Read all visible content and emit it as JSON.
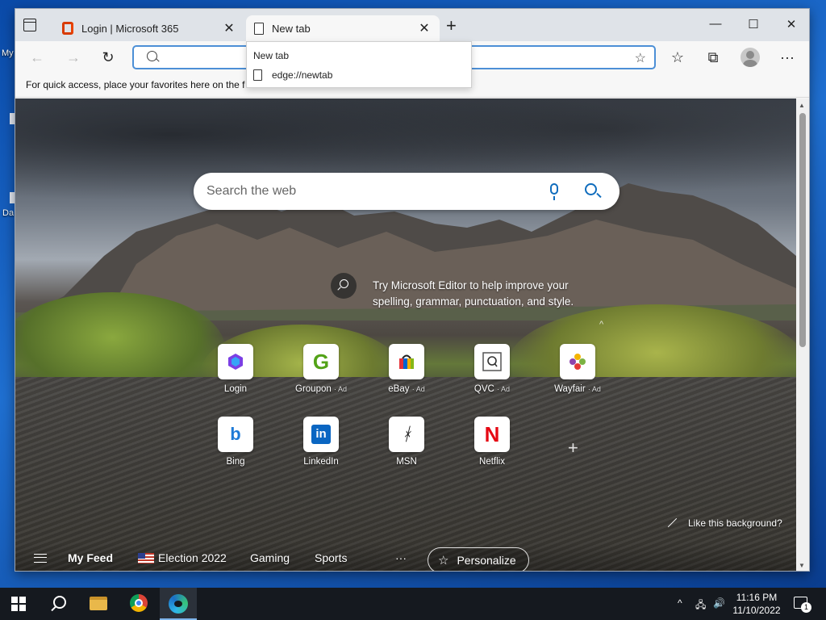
{
  "desktop": {
    "labels": [
      "My",
      "Da"
    ]
  },
  "browser": {
    "tabs": [
      {
        "title": "Login | Microsoft 365",
        "favicon": "office-icon",
        "active": false
      },
      {
        "title": "New tab",
        "favicon": "page-icon",
        "active": true
      }
    ],
    "new_tab_symbol": "+",
    "close_symbol": "✕",
    "window_controls": {
      "minimize": "—",
      "maximize": "☐",
      "close": "✕"
    },
    "nav": {
      "back": "←",
      "forward": "→",
      "refresh": "↻"
    },
    "address": {
      "value": "",
      "placeholder": ""
    },
    "toolbar_icons": {
      "favorites": "☆",
      "collections": "⧉",
      "menu": "···"
    },
    "favorites_bar_text": "For quick access, place your favorites here on the f",
    "dropdown": {
      "title": "New tab",
      "url": "edge://newtab"
    }
  },
  "newtab": {
    "search_placeholder": "Search the web",
    "editor_tip": "Try Microsoft Editor to help improve your spelling, grammar, punctuation, and style.",
    "caret": "^",
    "tiles": [
      {
        "label": "Login",
        "ad": "",
        "icon": "login-icon"
      },
      {
        "label": "Groupon",
        "ad": "· Ad",
        "icon": "groupon-icon"
      },
      {
        "label": "eBay",
        "ad": "· Ad",
        "icon": "ebay-icon"
      },
      {
        "label": "QVC",
        "ad": "· Ad",
        "icon": "qvc-icon"
      },
      {
        "label": "Wayfair",
        "ad": "· Ad",
        "icon": "wayfair-icon"
      },
      {
        "label": "Bing",
        "ad": "",
        "icon": "bing-icon"
      },
      {
        "label": "LinkedIn",
        "ad": "",
        "icon": "linkedin-icon"
      },
      {
        "label": "MSN",
        "ad": "",
        "icon": "msn-icon"
      },
      {
        "label": "Netflix",
        "ad": "",
        "icon": "netflix-icon"
      }
    ],
    "add_tile_symbol": "+",
    "like_background": "Like this background?",
    "feed": {
      "my_feed": "My Feed",
      "items": [
        "Election 2022",
        "Gaming",
        "Sports"
      ],
      "more": "···",
      "personalize": "Personalize"
    }
  },
  "taskbar": {
    "time": "11:16 PM",
    "date": "11/10/2022",
    "notification_count": "1",
    "tray": {
      "chevron": "^",
      "network": "🖧",
      "volume": "🔊"
    }
  }
}
